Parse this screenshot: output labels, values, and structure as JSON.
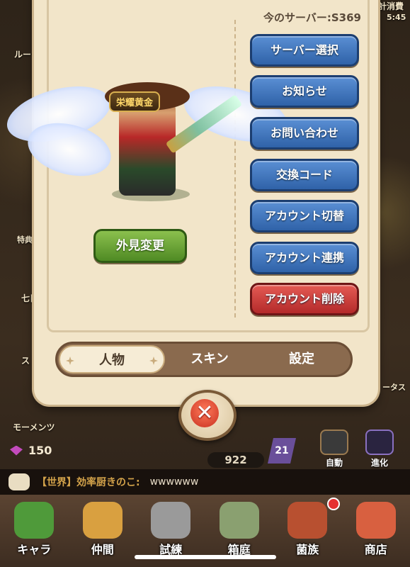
{
  "background": {
    "left_labels": [
      "ルー",
      "特典",
      "七日",
      "ス",
      "モーメンツ"
    ],
    "right_labels": [
      "計消費",
      "5:45",
      "ータス"
    ],
    "gems": "150",
    "score": "922",
    "level": "21",
    "side_buttons": [
      {
        "label": "自動",
        "icon": "auto-gear-icon"
      },
      {
        "label": "進化",
        "icon": "evolve-icon"
      }
    ],
    "chat": {
      "channel": "【世界】効率厨きのこ:",
      "message": "wwwwww"
    }
  },
  "bottom_nav": [
    {
      "label": "キャラ",
      "icon": "mushroom-icon",
      "color": "#4f9a3a"
    },
    {
      "label": "仲間",
      "icon": "paw-icon",
      "color": "#d9a040"
    },
    {
      "label": "試練",
      "icon": "crossed-swords-icon",
      "color": "#9a9a9a"
    },
    {
      "label": "箱庭",
      "icon": "garden-icon",
      "color": "#8aa070"
    },
    {
      "label": "菌族",
      "icon": "skull-banner-icon",
      "color": "#b85030"
    },
    {
      "label": "商店",
      "icon": "shop-icon",
      "color": "#d86040"
    }
  ],
  "dialog": {
    "current_server": "今のサーバー:S369",
    "title_badge": "栄耀黄金",
    "appearance_button": "外見変更",
    "menu_buttons": [
      {
        "label": "サーバー選択",
        "style": "blue"
      },
      {
        "label": "お知らせ",
        "style": "blue"
      },
      {
        "label": "お問い合わせ",
        "style": "blue"
      },
      {
        "label": "交換コード",
        "style": "blue"
      },
      {
        "label": "アカウント切替",
        "style": "blue"
      },
      {
        "label": "アカウント連携",
        "style": "blue"
      },
      {
        "label": "アカウント削除",
        "style": "red"
      }
    ],
    "tabs": {
      "character": "人物",
      "skin": "スキン",
      "settings": "設定",
      "active": "character"
    },
    "close_symbol": "✕"
  },
  "colors": {
    "accent_blue": "#2f62a8",
    "danger_red": "#b42a2a",
    "panel": "#f2e5c9",
    "confirm_green": "#4f8a24"
  }
}
